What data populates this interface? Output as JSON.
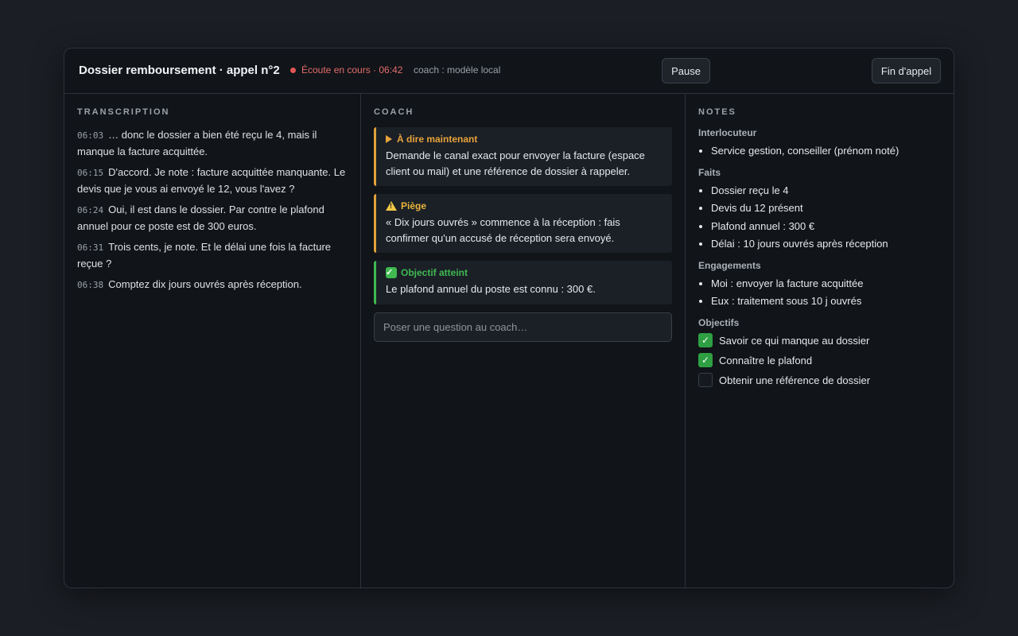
{
  "header": {
    "title": "Dossier remboursement · appel n°2",
    "status": "Écoute en cours · 06:42",
    "model": "coach : modèle local",
    "pause_label": "Pause",
    "end_label": "Fin d'appel"
  },
  "transcription": {
    "heading": "TRANSCRIPTION",
    "lines": [
      {
        "time": "06:03",
        "text": "… donc le dossier a bien été reçu le 4, mais il manque la facture acquittée."
      },
      {
        "time": "06:15",
        "text": "D'accord. Je note : facture acquittée manquante. Le devis que je vous ai envoyé le 12, vous l'avez ?"
      },
      {
        "time": "06:24",
        "text": "Oui, il est dans le dossier. Par contre le plafond annuel pour ce poste est de 300 euros."
      },
      {
        "time": "06:31",
        "text": "Trois cents, je note. Et le délai une fois la facture reçue ?"
      },
      {
        "time": "06:38",
        "text": "Comptez dix jours ouvrés après réception."
      }
    ]
  },
  "coach": {
    "heading": "COACH",
    "cards": [
      {
        "icon": "play-icon",
        "title": "À dire maintenant",
        "body": "Demande le canal exact pour envoyer la facture (espace client ou mail) et une référence de dossier à rappeler.",
        "accent": "#e0a23a"
      },
      {
        "icon": "warning-icon",
        "title": "Piège",
        "body": "« Dix jours ouvrés » commence à la réception : fais confirmer qu'un accusé de réception sera envoyé.",
        "accent": "#e0a23a"
      },
      {
        "icon": "check-icon",
        "title": "Objectif atteint",
        "body": "Le plafond annuel du poste est connu : 300 €.",
        "accent": "#3fb950"
      }
    ],
    "ask_placeholder": "Poser une question au coach…"
  },
  "notes": {
    "heading": "NOTES",
    "interlocutor_heading": "Interlocuteur",
    "interlocutor": [
      "Service gestion, conseiller (prénom noté)"
    ],
    "facts_heading": "Faits",
    "facts": [
      "Dossier reçu le 4",
      "Devis du 12 présent",
      "Plafond annuel : 300 €",
      "Délai : 10 jours ouvrés après réception"
    ],
    "commitments_heading": "Engagements",
    "commitments": [
      "Moi : envoyer la facture acquittée",
      "Eux : traitement sous 10 j ouvrés"
    ],
    "objectives_heading": "Objectifs",
    "objectives": [
      {
        "label": "Savoir ce qui manque au dossier",
        "checked": true
      },
      {
        "label": "Connaître le plafond",
        "checked": true
      },
      {
        "label": "Obtenir une référence de dossier",
        "checked": false
      }
    ]
  }
}
